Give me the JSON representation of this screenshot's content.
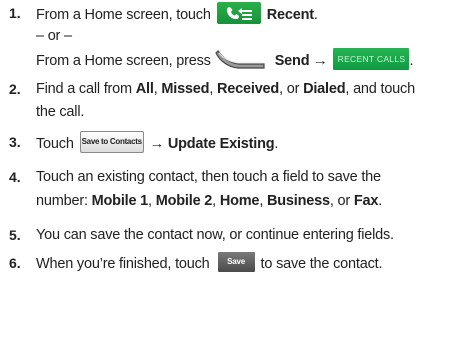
{
  "steps": [
    {
      "number": "1.",
      "line1": {
        "pre": "From a Home screen, touch",
        "button_icon": "recent-calls-icon",
        "bold": "Recent",
        "post": "."
      },
      "or": "– or –",
      "line3": {
        "pre": "From a Home screen, press",
        "key_icon": "send-key-icon",
        "bold": "Send →",
        "button_label": "RECENT CALLS",
        "post": "."
      }
    },
    {
      "number": "2.",
      "line1": {
        "pre": "Find a call from ",
        "b1": "All",
        "s1": ", ",
        "b2": "Missed",
        "s2": ", ",
        "b3": "Received",
        "s3": ", or ",
        "b4": "Dialed",
        "post": ", and touch"
      },
      "line2": "the call."
    },
    {
      "number": "3.",
      "pre": "Touch",
      "button_label": "Save to Contacts",
      "bold": "→ Update Existing",
      "post": "."
    },
    {
      "number": "4.",
      "line1": "Touch an existing contact, then touch a field to save the",
      "line2": {
        "pre": "number: ",
        "b1": "Mobile 1",
        "s1": ", ",
        "b2": "Mobile 2",
        "s2": ", ",
        "b3": "Home",
        "s3": ", ",
        "b4": "Business",
        "s4": ", or ",
        "b5": "Fax",
        "post": "."
      }
    },
    {
      "number": "5.",
      "text": "You can save the contact now, or continue entering fields."
    },
    {
      "number": "6.",
      "pre": "When you’re finished, touch",
      "button_label": "Save",
      "post": "to save the contact."
    }
  ],
  "colors": {
    "text": "#222222",
    "green_button": "#1a9a3e",
    "gray_button": "#5a5a5a"
  }
}
